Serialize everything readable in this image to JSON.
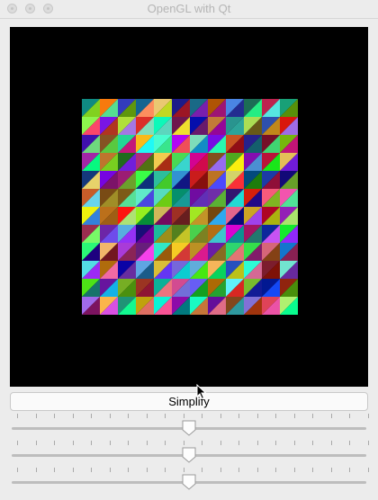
{
  "window": {
    "title": "OpenGL with Qt"
  },
  "controls": {
    "simplify_label": "Simplify"
  },
  "sliders": [
    {
      "name": "slider-1",
      "value": 0.5
    },
    {
      "name": "slider-2",
      "value": 0.5
    },
    {
      "name": "slider-3",
      "value": 0.5
    }
  ],
  "mesh": {
    "rows": 12,
    "cols": 12
  },
  "colors": {
    "window_bg": "#ececec",
    "viewport_bg": "#000000",
    "button_bg": "#fafafa"
  }
}
